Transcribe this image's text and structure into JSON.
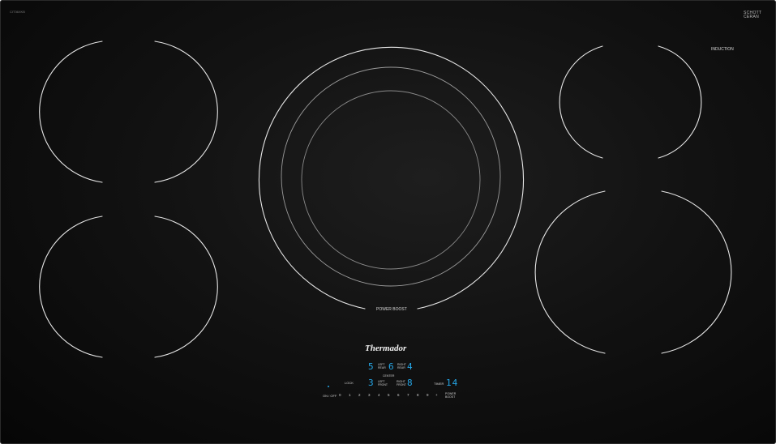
{
  "cooktop": {
    "model_label": "CIT36XKB",
    "glass_brand": [
      "SCHOTT",
      "CERAN"
    ],
    "induction_label": "INDUCTION",
    "power_boost_label": "POWER BOOST",
    "brand": "Thermador"
  },
  "controls": {
    "left_rear": {
      "value": "5",
      "label": [
        "LEFT",
        "REAR"
      ]
    },
    "right_rear": {
      "value": "6",
      "label": [
        "RIGHT",
        "REAR"
      ]
    },
    "center_value": "4",
    "center_label": "CENTER",
    "left_front": {
      "value": "3",
      "label": [
        "LEFT",
        "FRONT"
      ]
    },
    "right_front": {
      "value": "8",
      "label": [
        "RIGHT",
        "FRONT"
      ]
    },
    "lock_label": "LOCK",
    "timer_label": "TIMER",
    "timer_value": "14",
    "on_off_label": "ON / OFF",
    "slider_levels": [
      "0",
      "1",
      "2",
      "3",
      "4",
      "5",
      "6",
      "7",
      "8",
      "9",
      "+"
    ],
    "power_boost_label": [
      "POWER",
      "BOOST"
    ]
  },
  "colors": {
    "display_blue": "#25a7e8",
    "glass": "#121212",
    "ring": "#e6e6e6"
  }
}
